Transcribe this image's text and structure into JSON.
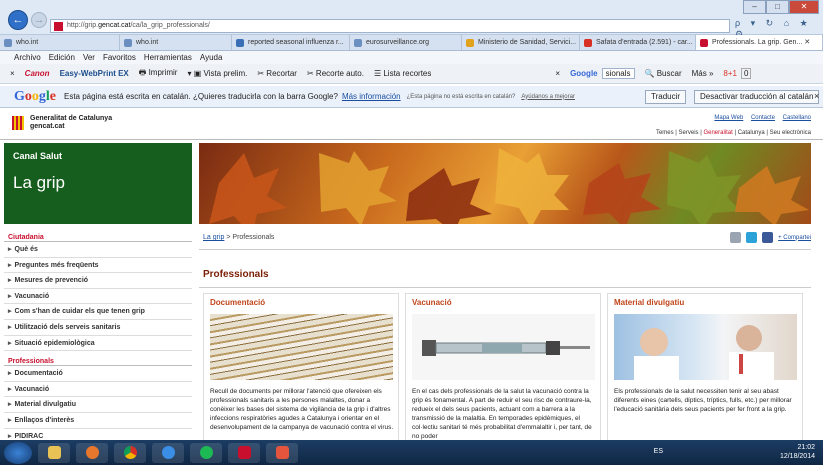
{
  "browser": {
    "url_prefix": "http://grip.",
    "url_domain": "gencat.cat",
    "url_path": "/ca/la_grip_professionals/",
    "search_glyphs": "ρ ▾ ↻",
    "right_icons": "⌂ ★ ⚙",
    "window_controls": [
      "–",
      "□",
      "✕"
    ],
    "back_glyph": "←",
    "fwd_glyph": "→"
  },
  "tabs": [
    {
      "label": "who.int"
    },
    {
      "label": "who.int"
    },
    {
      "label": "reported seasonal influenza r..."
    },
    {
      "label": "eurosurveillance.org"
    },
    {
      "label": "Ministerio de Sanidad, Servici..."
    },
    {
      "label": "Safata d'entrada (2.591) - car..."
    },
    {
      "label": "Professionals. La grip. Gen..."
    }
  ],
  "tab_close": "✕",
  "menu": [
    "Archivo",
    "Edición",
    "Ver",
    "Favoritos",
    "Herramientas",
    "Ayuda"
  ],
  "toolbar": {
    "close": "×",
    "canon": "Canon",
    "easy": "Easy-WebPrint EX",
    "print": "Imprimir",
    "preview": "Vista prelim.",
    "cut": "Recortar",
    "autocut": "Recorte auto.",
    "recent": "Lista recortes",
    "google_close": "×",
    "google": "Google",
    "google_box": "sionals",
    "search": "Buscar",
    "more": "Más »",
    "plus": "8+1",
    "count": "0"
  },
  "translate": {
    "logo": [
      "G",
      "o",
      "o",
      "g",
      "l",
      "e"
    ],
    "message": "Esta página está escrita en catalán. ¿Quieres traducirla con la barra Google?",
    "more_info": "Más información",
    "small_text": "¿Esta página no está escrita en catalán?",
    "help": "Ayúdanos a mejorar",
    "translate_btn": "Traducir",
    "disable_btn": "Desactivar traducción al catalán",
    "close": "×"
  },
  "site": {
    "brand_line1": "Generalitat de Catalunya",
    "brand_line2": "gencat.cat",
    "top_links": [
      "Mapa Web",
      "Contacte",
      "Castellano"
    ],
    "section_links": [
      "Temes",
      "Serveis",
      "Generalitat",
      "Catalunya",
      "Seu electrònica"
    ],
    "section_sep": "|",
    "canal": "Canal Salut",
    "grip_title": "La grip"
  },
  "sidebar": {
    "ciutadania": "Ciutadania",
    "ciutadania_items": [
      "Què és",
      "Preguntes més freqüents",
      "Mesures de prevenció",
      "Vacunació",
      "Com s'han de cuidar els que tenen grip",
      "Utilització dels serveis sanitaris",
      "Situació epidemiològica"
    ],
    "professionals": "Professionals",
    "professionals_items": [
      "Documentació",
      "Vacunació",
      "Material divulgatiu",
      "Enllaços d'interès",
      "PIDIRAC"
    ]
  },
  "breadcrumb": {
    "home": "La grip",
    "sep": ">",
    "current": "Professionals"
  },
  "share": {
    "label": "+ Compartei"
  },
  "page_title": "Professionals",
  "columns": [
    {
      "title": "Documentació",
      "text": "Recull de documents per millorar l'atenció que ofereixen els professionals sanitaris a les persones malaltes, donar a conèixer les bases del sistema de vigilància de la grip i d'altres infeccions respiratòries agudes a Catalunya i orientar en el desenvolupament de la campanya de vacunació contra el virus."
    },
    {
      "title": "Vacunació",
      "text": "En el cas dels professionals de la salut la vacunació contra la grip és fonamental. A part de reduir el seu risc de contraure-la, redueix el dels seus pacients, actuant com a barrera a la transmissió de la malaltia. En temporades epidèmiques, el col·lectiu sanitari té més probabilitat d'emmalaltir i, per tant, de no poder"
    },
    {
      "title": "Material divulgatiu",
      "text": "Els professionals de la salut necessiten tenir al seu abast diferents eines (cartells, díptics, tríptics, fulls, etc.) per millorar l'educació sanitària dels seus pacients per fer front a la grip."
    }
  ],
  "taskbar": {
    "lang": "ES",
    "time": "21:02",
    "date": "12/18/2014"
  }
}
